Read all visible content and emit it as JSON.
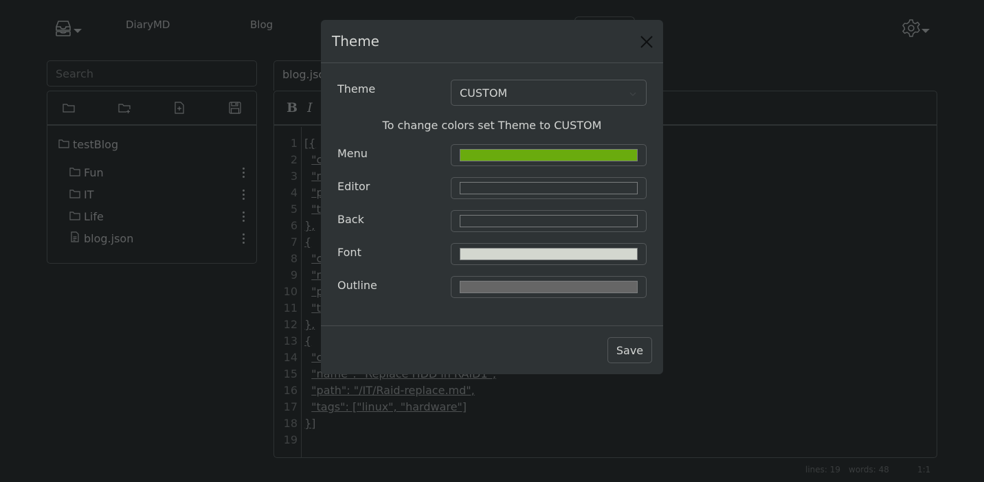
{
  "nav": {
    "logo_icon": "inbox-stack-icon",
    "links": [
      "DiaryMD",
      "Blog"
    ],
    "settings_icon": "gear-icon"
  },
  "sidebar": {
    "search_placeholder": "Search",
    "toolbar_icons": [
      "open-folder-icon",
      "new-folder-icon",
      "new-file-icon",
      "save-icon"
    ],
    "tree": {
      "root": "testBlog",
      "items": [
        {
          "label": "Fun",
          "type": "folder"
        },
        {
          "label": "IT",
          "type": "folder"
        },
        {
          "label": "Life",
          "type": "folder"
        },
        {
          "label": "blog.json",
          "type": "file"
        }
      ]
    }
  },
  "editor": {
    "tab_label": "blog.jso",
    "toolbar": {
      "bold": "B",
      "italic": "I"
    },
    "line_numbers": [
      "1",
      "2",
      "3",
      "4",
      "5",
      "6",
      "7",
      "8",
      "9",
      "10",
      "11",
      "12",
      "13",
      "14",
      "15",
      "16",
      "17",
      "18",
      "19"
    ],
    "lines": [
      "[{",
      "  \"c",
      "  \"n",
      "  \"p",
      "  \"t",
      "},",
      "{",
      "  \"c",
      "  \"n",
      "  \"p",
      "  \"t",
      "},",
      "{",
      "  \"c",
      "  \"name\": \"Replace HDD in RAID1\",",
      "  \"path\": \"/IT/Raid-replace.md\",",
      "  \"tags\": [\"linux\", \"hardware\"]",
      "}]",
      ""
    ],
    "status": {
      "lines": "lines: 19",
      "words": "words: 48",
      "cursor": "1:1"
    }
  },
  "modal": {
    "title": "Theme",
    "close_icon": "close-icon",
    "theme_label": "Theme",
    "theme_value": "CUSTOM",
    "hint": "To change colors set Theme to CUSTOM",
    "colors": [
      {
        "label": "Menu",
        "value": "#6aab0e"
      },
      {
        "label": "Editor",
        "value": "#2e3335"
      },
      {
        "label": "Back",
        "value": "#2e3335"
      },
      {
        "label": "Font",
        "value": "#d3d7cf"
      },
      {
        "label": "Outline",
        "value": "#666666"
      }
    ],
    "save_label": "Save"
  }
}
